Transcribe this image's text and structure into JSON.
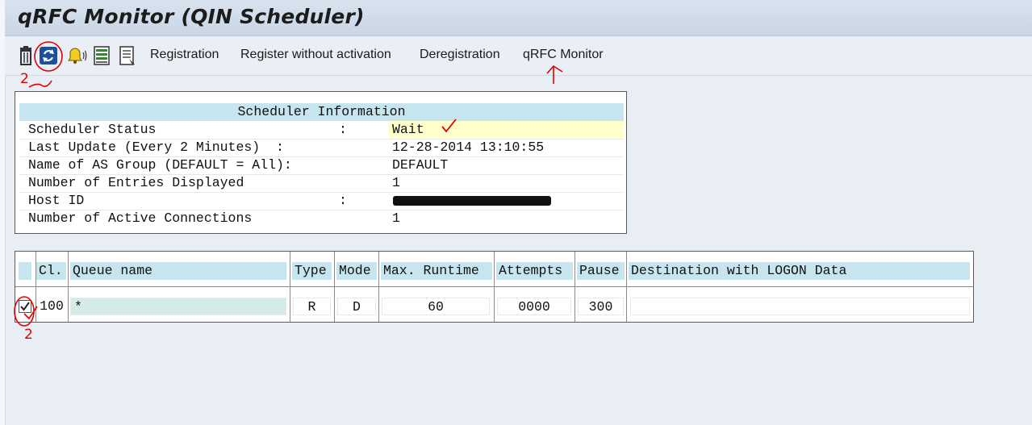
{
  "window": {
    "title": "qRFC Monitor (QIN Scheduler)"
  },
  "toolbar": {
    "icons": [
      "trash-icon",
      "refresh-icon",
      "bell-icon",
      "document-green-icon",
      "document-list-icon"
    ],
    "links": [
      "Registration",
      "Register without activation",
      "Deregistration",
      "qRFC Monitor"
    ]
  },
  "scheduler_info": {
    "header": "Scheduler Information",
    "rows": [
      {
        "label": "Scheduler Status",
        "colon": ":",
        "value": "Wait"
      },
      {
        "label": "Last Update (Every 2 Minutes)  :",
        "colon": "",
        "value": "12-28-2014 13:10:55"
      },
      {
        "label": "Name of AS Group (DEFAULT = All):",
        "colon": "",
        "value": "DEFAULT"
      },
      {
        "label": "Number of Entries Displayed",
        "colon": "",
        "value": "1"
      },
      {
        "label": "Host ID",
        "colon": ":",
        "value": ""
      },
      {
        "label": "Number of Active Connections",
        "colon": "",
        "value": "1"
      }
    ]
  },
  "queue_table": {
    "columns": [
      "Cl.",
      "Queue name",
      "Type",
      "Mode",
      "Max. Runtime",
      "Attempts",
      "Pause",
      "Destination with LOGON Data"
    ],
    "rows": [
      {
        "checked": true,
        "client": "100",
        "queue": "*",
        "type": "R",
        "mode": "D",
        "max_runtime": "60",
        "attempts": "0000",
        "pause": "300",
        "destination": ""
      }
    ]
  },
  "annotations": {
    "step_labels": [
      "2",
      "2"
    ],
    "color": "#e00000"
  }
}
